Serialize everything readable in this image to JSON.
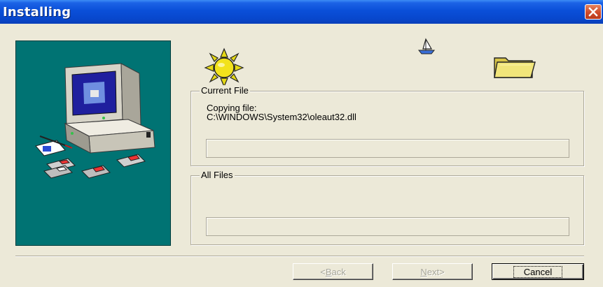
{
  "window": {
    "title": "Installing"
  },
  "current_file": {
    "legend": "Current File",
    "copy_label": "Copying file:",
    "copy_path": "C:\\WINDOWS\\System32\\oleaut32.dll",
    "progress": 0
  },
  "all_files": {
    "legend": "All Files",
    "progress": 0
  },
  "buttons": {
    "back": {
      "mnemonic": "B",
      "rest": "ack",
      "prefix": "< ",
      "enabled": false
    },
    "next": {
      "mnemonic": "N",
      "rest": "ext",
      "suffix": " >",
      "enabled": false
    },
    "cancel": {
      "label": "Cancel",
      "enabled": true
    }
  },
  "icons": [
    "sun-icon",
    "sailboat-icon",
    "folder-icon",
    "computer-illustration",
    "close-icon"
  ],
  "colors": {
    "titlebar": "#0a4fd8",
    "side_panel": "#007373",
    "dialog_bg": "#ece9d8",
    "close_button": "#cf4a2a"
  }
}
